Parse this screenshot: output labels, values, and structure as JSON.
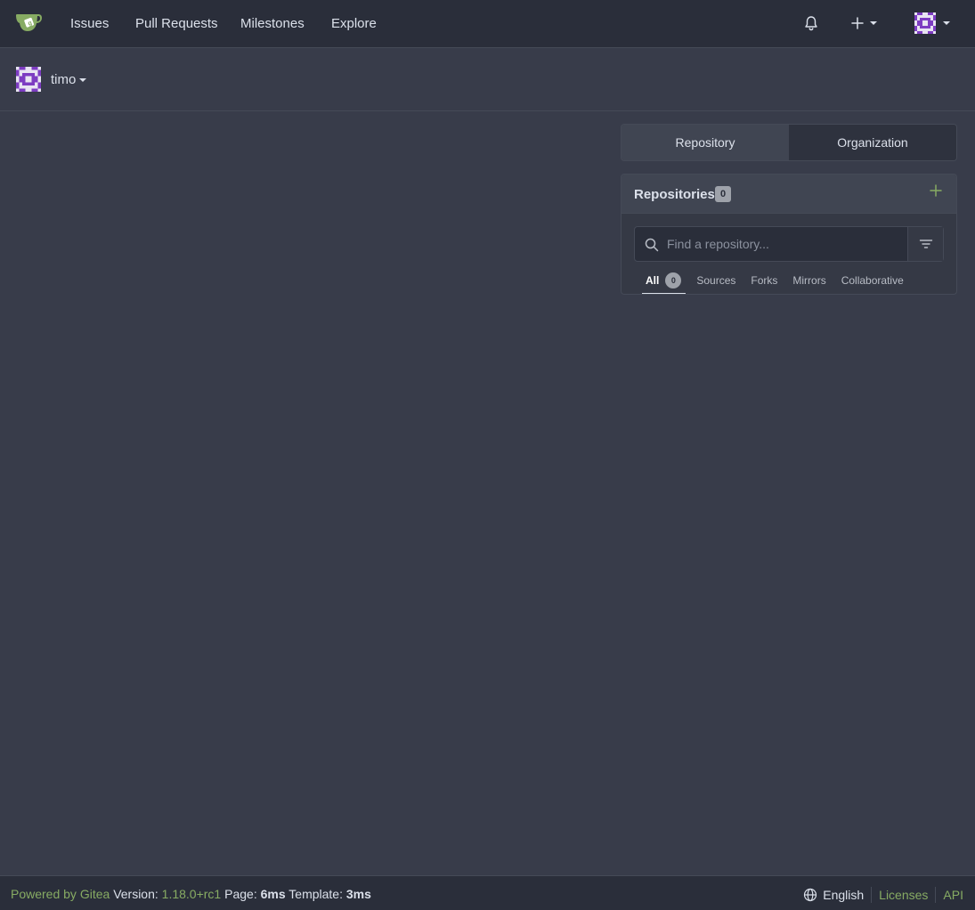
{
  "nav": {
    "items": [
      "Issues",
      "Pull Requests",
      "Milestones",
      "Explore"
    ]
  },
  "context": {
    "user": "timo"
  },
  "switcher": {
    "repository": "Repository",
    "organization": "Organization"
  },
  "repos": {
    "title": "Repositories",
    "count": "0",
    "search_placeholder": "Find a repository...",
    "tabs": [
      {
        "label": "All",
        "count": "0"
      },
      {
        "label": "Sources"
      },
      {
        "label": "Forks"
      },
      {
        "label": "Mirrors"
      },
      {
        "label": "Collaborative"
      }
    ]
  },
  "footer": {
    "powered": "Powered by Gitea",
    "version_label": "Version:",
    "version": "1.18.0+rc1",
    "page_label": "Page:",
    "page_time": "6ms",
    "template_label": "Template:",
    "template_time": "3ms",
    "language": "English",
    "licenses": "Licenses",
    "api": "API"
  },
  "colors": {
    "accent": "#87ab63",
    "background": "#383c4a",
    "nav_bg": "#2a2e3a",
    "avatar_purple": "#7d3cc2"
  },
  "icons": [
    "gitea-logo-icon",
    "bell-icon",
    "plus-icon",
    "avatar",
    "search-icon",
    "filter-icon",
    "globe-icon"
  ]
}
